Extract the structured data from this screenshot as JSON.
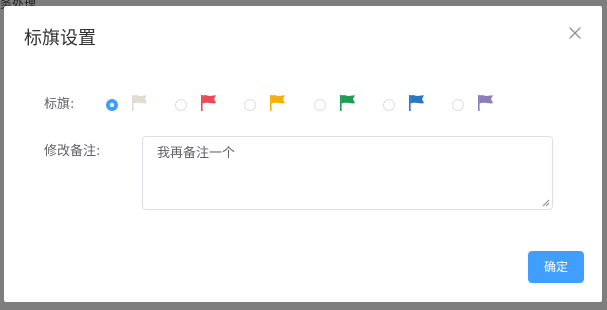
{
  "background": {
    "partial_text": "务处理"
  },
  "dialog": {
    "title": "标旗设置",
    "flag_label": "标旗:",
    "remark_label": "修改备注:",
    "remark_value": "我再备注一个",
    "confirm_label": "确定",
    "selected_flag_index": 0,
    "flags": [
      {
        "name": "none",
        "color": "#e0dbd3"
      },
      {
        "name": "red",
        "color": "#f04756"
      },
      {
        "name": "yellow",
        "color": "#f2b20a"
      },
      {
        "name": "green",
        "color": "#1f9d55"
      },
      {
        "name": "blue",
        "color": "#2a76c6"
      },
      {
        "name": "purple",
        "color": "#8b7db8"
      }
    ],
    "colors": {
      "primary": "#409eff"
    }
  }
}
